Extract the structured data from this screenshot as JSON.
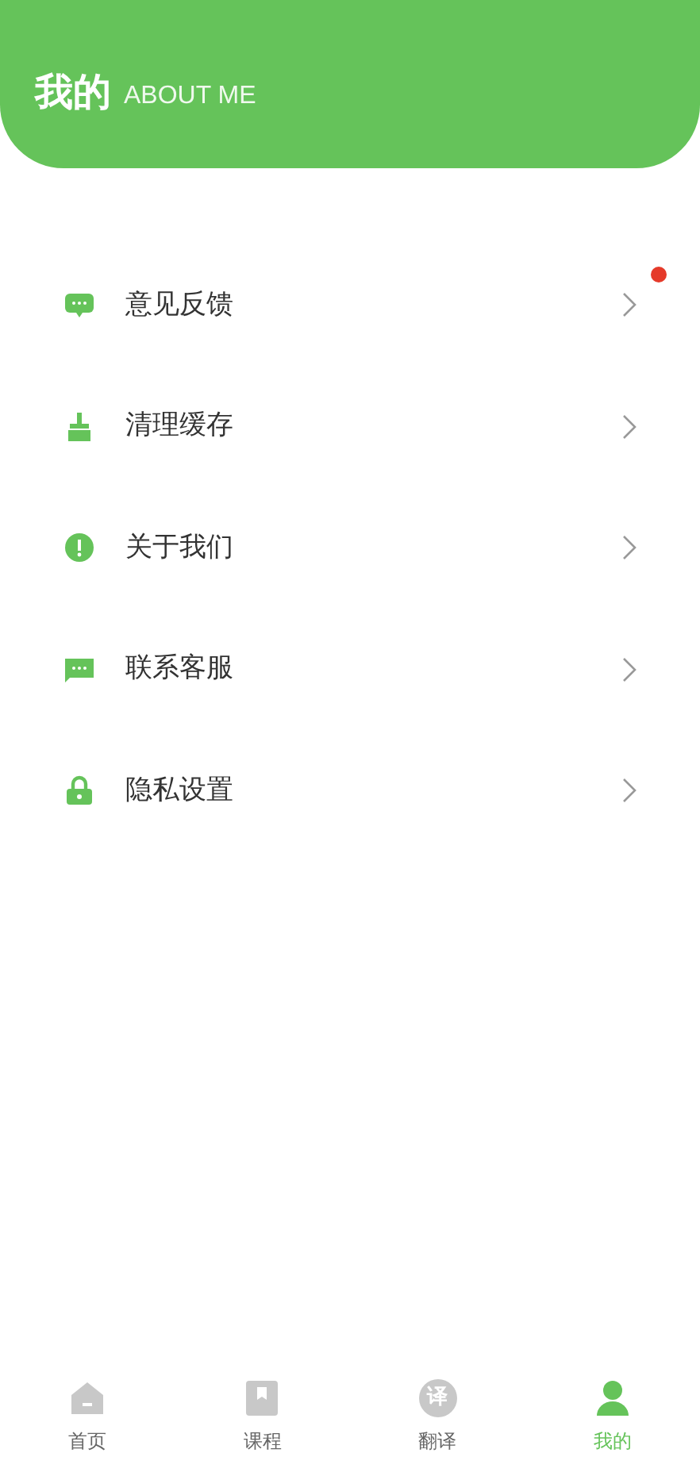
{
  "header": {
    "title": "我的",
    "subtitle": "ABOUT ME"
  },
  "menu": [
    {
      "kind": "feedback",
      "label": "意见反馈",
      "badge": true
    },
    {
      "kind": "clean",
      "label": "清理缓存",
      "badge": false
    },
    {
      "kind": "about",
      "label": "关于我们",
      "badge": false
    },
    {
      "kind": "service",
      "label": "联系客服",
      "badge": false
    },
    {
      "kind": "privacy",
      "label": "隐私设置",
      "badge": false
    }
  ],
  "tabs": [
    {
      "kind": "home",
      "label": "首页",
      "selected": false
    },
    {
      "kind": "course",
      "label": "课程",
      "selected": false
    },
    {
      "kind": "translate",
      "label": "翻译",
      "icon_text": "译",
      "selected": false
    },
    {
      "kind": "me",
      "label": "我的",
      "selected": true
    }
  ]
}
